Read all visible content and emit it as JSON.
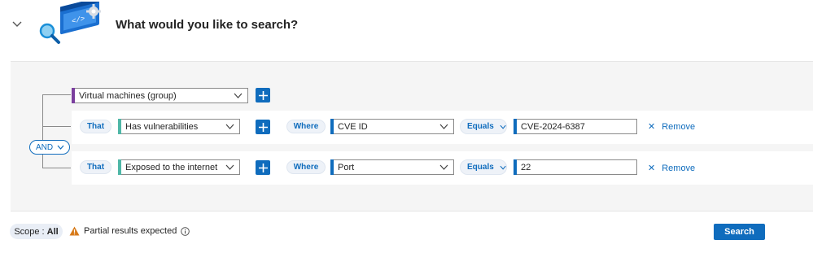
{
  "header": {
    "title": "What would you like to search?",
    "collapse_icon": "chevron-down-icon",
    "illustration_icon": "code-search-illustration-icon"
  },
  "query": {
    "operator": "AND",
    "root": {
      "value": "Virtual machines (group)",
      "accent_color": "#7b3f9e"
    },
    "conditions": [
      {
        "that_label": "That",
        "relationship": "Has vulnerabilities",
        "where_label": "Where",
        "property": "CVE ID",
        "comparator": "Equals",
        "value": "CVE-2024-6387",
        "remove_label": "Remove"
      },
      {
        "that_label": "That",
        "relationship": "Exposed to the internet",
        "where_label": "Where",
        "property": "Port",
        "comparator": "Equals",
        "value": "22",
        "remove_label": "Remove"
      }
    ]
  },
  "footer": {
    "scope_label": "Scope :",
    "scope_value": "All",
    "warning_text": "Partial results expected",
    "search_label": "Search"
  },
  "colors": {
    "accent": "#0f6cbd",
    "relationship_accent": "#4fb7a7",
    "warning": "#d77a1a"
  }
}
